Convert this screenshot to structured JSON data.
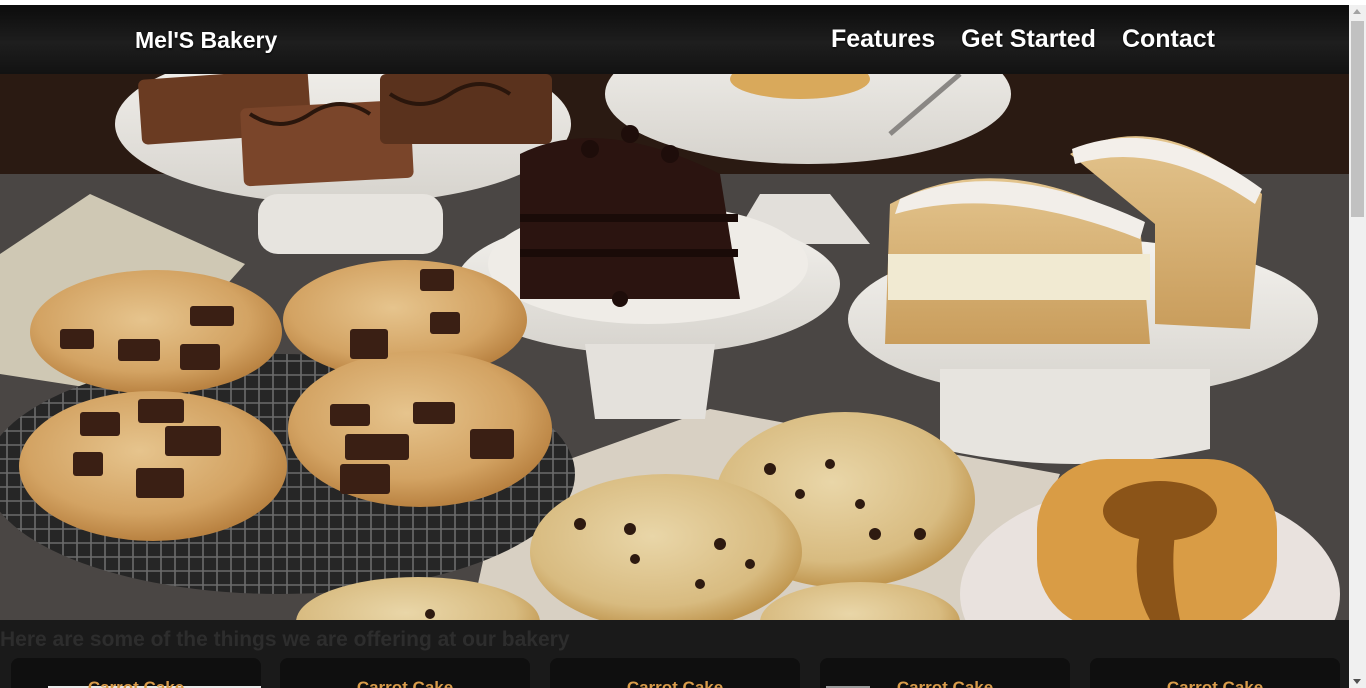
{
  "nav": {
    "brand": "Mel'S Bakery",
    "links": [
      {
        "label": "Features"
      },
      {
        "label": "Get Started"
      },
      {
        "label": "Contact"
      }
    ]
  },
  "offerings": {
    "heading": "Here are some of the things we are offering at our bakery",
    "cards": [
      {
        "title": "Carrot Cake"
      },
      {
        "title": "Carrot Cake"
      },
      {
        "title": "Carrot Cake"
      },
      {
        "title": "Carrot Cake"
      },
      {
        "title": "Carrot Cake"
      }
    ]
  },
  "colors": {
    "navbar": "#111111",
    "card_title": "#d99c4a",
    "section_bg": "#1a1a1a"
  }
}
